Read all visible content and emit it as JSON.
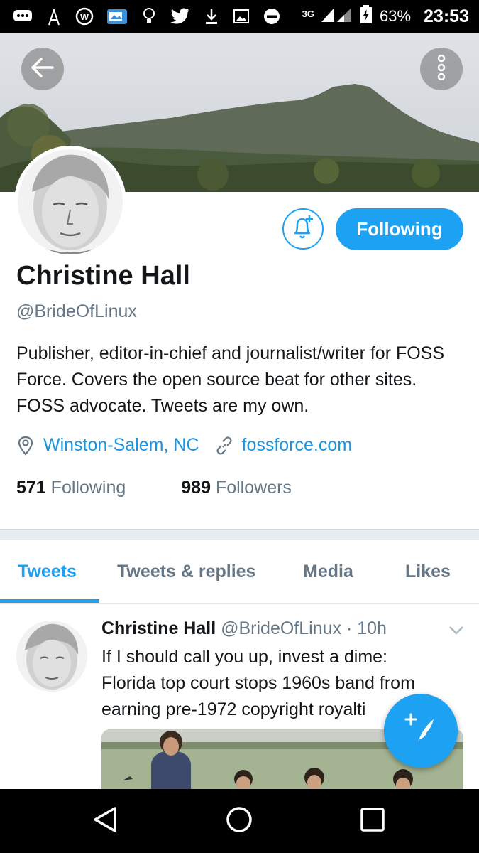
{
  "status_bar": {
    "network": "3G",
    "battery": "63%",
    "time": "23:53",
    "icons": [
      "chat-icon",
      "antenna-icon",
      "wordpress-icon",
      "gallery-icon",
      "lightbulb-icon",
      "twitter-icon",
      "download-icon",
      "image-icon",
      "dnd-icon",
      "signal-icon",
      "battery-icon"
    ]
  },
  "header": {
    "back_icon": "back-arrow-icon",
    "more_icon": "more-vertical-icon"
  },
  "profile": {
    "name": "Christine Hall",
    "handle": "@BrideOfLinux",
    "bio": "Publisher, editor-in-chief and journalist/writer for FOSS Force. Covers the open source beat for other sites. FOSS advocate. Tweets are my own.",
    "location": "Winston-Salem, NC",
    "website": "fossforce.com",
    "following_count": "571",
    "following_label": "Following",
    "followers_count": "989",
    "followers_label": "Followers",
    "follow_button": "Following",
    "notify_icon": "bell-plus-icon"
  },
  "tabs": [
    {
      "label": "Tweets",
      "active": true
    },
    {
      "label": "Tweets & replies",
      "active": false
    },
    {
      "label": "Media",
      "active": false
    },
    {
      "label": "Likes",
      "active": false
    }
  ],
  "tweet": {
    "author": "Christine Hall",
    "handle": "@BrideOfLinux",
    "separator": "·",
    "time": "10h",
    "text_lines": [
      "If I should call you up, invest a dime:",
      "Florida top court stops 1960s band from",
      "earning pre-1972 copyright royalti"
    ]
  },
  "fab": {
    "icon": "compose-tweet-icon"
  },
  "nav": {
    "icons": [
      "back-icon",
      "home-icon",
      "recents-icon"
    ]
  },
  "colors": {
    "accent": "#1da1f2",
    "link": "#1b95e0",
    "muted": "#657786",
    "text": "#14171a"
  }
}
